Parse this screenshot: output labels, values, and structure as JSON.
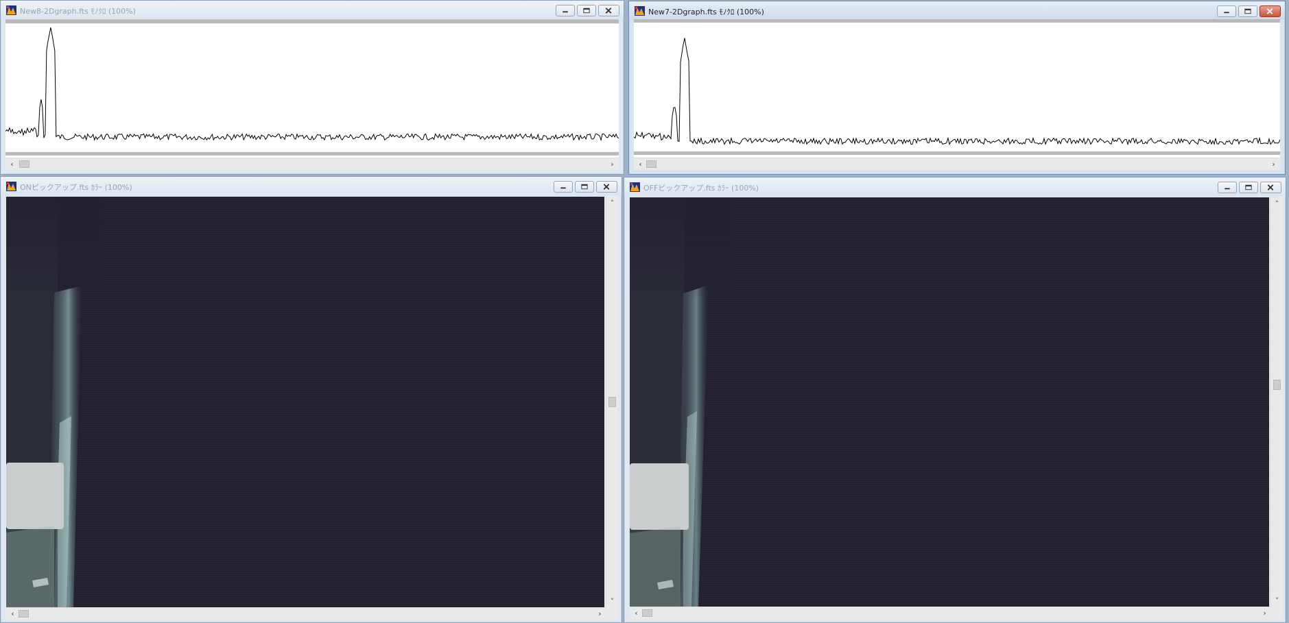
{
  "windows": [
    {
      "title": "New8-2Dgraph.fts ﾓﾉｸﾛ (100%)",
      "active": false
    },
    {
      "title": "New7-2Dgraph.fts ﾓﾉｸﾛ (100%)",
      "active": true
    },
    {
      "title": "ONピックアップ.fts ｶﾗｰ (100%)",
      "active": false
    },
    {
      "title": "OFFピックアップ.fts ｶﾗｰ (100%)",
      "active": false
    }
  ],
  "icons": {
    "app": "fits-image-app-icon",
    "minimize": "minimize-icon",
    "maximize": "maximize-icon",
    "close": "close-icon",
    "scroll_left": "‹",
    "scroll_right": "›",
    "scroll_up": "˄",
    "scroll_down": "˅"
  },
  "colors": {
    "image_background": "#23212f",
    "graph_line": "#000000",
    "active_close": "#c75640"
  }
}
